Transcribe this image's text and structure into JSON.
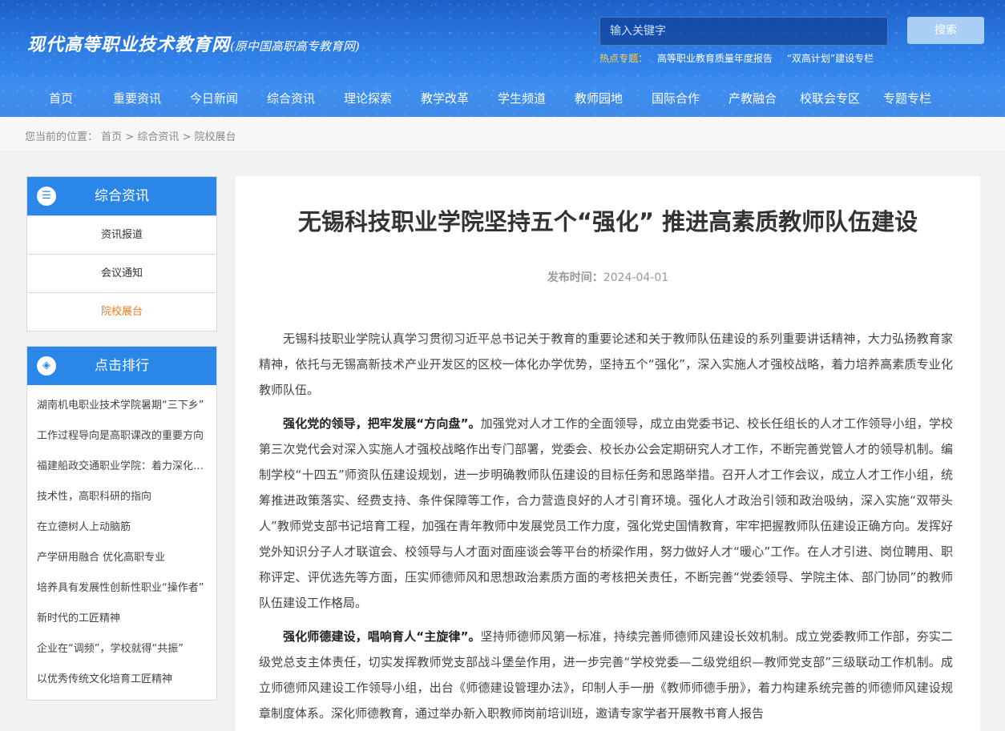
{
  "header": {
    "logo_main": "现代高等职业技术教育网",
    "logo_sub": "(原中国高职高专教育网)",
    "search_placeholder": "输入关键字",
    "search_button": "搜索",
    "hot_label": "热点专题：",
    "hot_links": [
      "高等职业教育质量年度报告",
      "“双高计划”建设专栏"
    ]
  },
  "nav": [
    "首页",
    "重要资讯",
    "今日新闻",
    "综合资讯",
    "理论探索",
    "教学改革",
    "学生频道",
    "教师园地",
    "国际合作",
    "产教融合",
    "校联会专区",
    "专题专栏"
  ],
  "breadcrumb": {
    "label": "您当前的位置：",
    "items": [
      "首页",
      "综合资讯",
      "院校展台"
    ],
    "sep": " > "
  },
  "sidebar": {
    "category_title": "综合资讯",
    "category_items": [
      "资讯报道",
      "会议通知",
      "院校展台"
    ],
    "rank_title": "点击排行",
    "rank_items": [
      "湖南机电职业技术学院暑期“三下乡”",
      "工作过程导向是高职课改的重要方向",
      "福建船政交通职业学院：着力深化产教融合",
      "技术性，高职科研的指向",
      "在立德树人上动脑筋",
      "产学研用融合 优化高职专业",
      "培养具有发展性创新性职业“操作者”",
      "新时代的工匠精神",
      "企业在“调频”，学校就得“共振”",
      "以优秀传统文化培育工匠精神"
    ]
  },
  "article": {
    "title": "无锡科技职业学院坚持五个“强化” 推进高素质教师队伍建设",
    "date_label": "发布时间：",
    "date": "2024-04-01",
    "p1": "无锡科技职业学院认真学习贯彻习近平总书记关于教育的重要论述和关于教师队伍建设的系列重要讲话精神，大力弘扬教育家精神，依托与无锡高新技术产业开发区的区校一体化办学优势，坚持五个“强化”，深入实施人才强校战略，着力培养高素质专业化教师队伍。",
    "p2_lead": "强化党的领导，把牢发展“方向盘”。",
    "p2": "加强党对人才工作的全面领导，成立由党委书记、校长任组长的人才工作领导小组，学校第三次党代会对深入实施人才强校战略作出专门部署，党委会、校长办公会定期研究人才工作，不断完善党管人才的领导机制。编制学校“十四五”师资队伍建设规划，进一步明确教师队伍建设的目标任务和思路举措。召开人才工作会议，成立人才工作小组，统筹推进政策落实、经费支持、条件保障等工作，合力营造良好的人才引育环境。强化人才政治引领和政治吸纳，深入实施“双带头人”教师党支部书记培育工程，加强在青年教师中发展党员工作力度，强化党史国情教育，牢牢把握教师队伍建设正确方向。发挥好党外知识分子人才联谊会、校领导与人才面对面座谈会等平台的桥梁作用，努力做好人才“暖心”工作。在人才引进、岗位聘用、职称评定、评优选先等方面，压实师德师风和思想政治素质方面的考核把关责任，不断完善“党委领导、学院主体、部门协同”的教师队伍建设工作格局。",
    "p3_lead": "强化师德建设，唱响育人“主旋律”。",
    "p3": "坚持师德师风第一标准，持续完善师德师风建设长效机制。成立党委教师工作部，夯实二级党总支主体责任，切实发挥教师党支部战斗堡垒作用，进一步完善“学校党委—二级党组织—教师党支部”三级联动工作机制。成立师德师风建设工作领导小组，出台《师德建设管理办法》，印制人手一册《教师师德手册》，着力构建系统完善的师德师风建设规章制度体系。深化师德教育，通过举办新入职教师岗前培训班，邀请专家学者开展教书育人报告"
  }
}
